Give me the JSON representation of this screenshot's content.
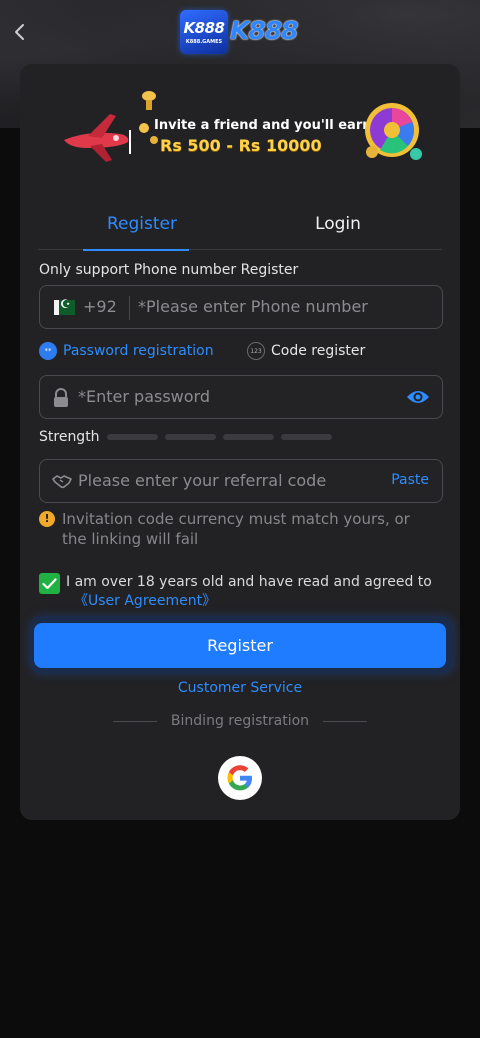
{
  "header": {
    "logo_badge_text": "K888",
    "logo_badge_subtext": "K888.GAMES",
    "logo_text": "K888"
  },
  "banner": {
    "line1": "Invite a friend and you'll earn",
    "line2": "Rs 500 - Rs 10000"
  },
  "tabs": {
    "register": "Register",
    "login": "Login",
    "active": "register"
  },
  "phone": {
    "label": "Only support Phone number Register",
    "dial_code": "+92",
    "required_mark": "*",
    "placeholder": "Please enter Phone number"
  },
  "registration_options": {
    "password": "Password registration",
    "code": "Code register",
    "selected": "password",
    "password_icon_text": "**",
    "code_icon_text": "123"
  },
  "password": {
    "required_mark": "*",
    "placeholder": "Enter password"
  },
  "strength": {
    "label": "Strength",
    "levels_filled": 0,
    "levels_total": 4
  },
  "referral": {
    "placeholder": "Please enter your referral code",
    "paste_label": "Paste"
  },
  "notice": {
    "icon_text": "!",
    "text": "Invitation code currency must match yours, or the linking will fail"
  },
  "agreement": {
    "checked": true,
    "text": "I am over 18 years old and have read and agreed to",
    "link": "《User Agreement》"
  },
  "actions": {
    "register_button": "Register",
    "customer_service": "Customer Service",
    "binding_label": "Binding registration"
  },
  "colors": {
    "accent": "#1f7cff",
    "link": "#2d8cff",
    "card": "#222224",
    "check": "#1fb141",
    "warning": "#f0a92a"
  }
}
